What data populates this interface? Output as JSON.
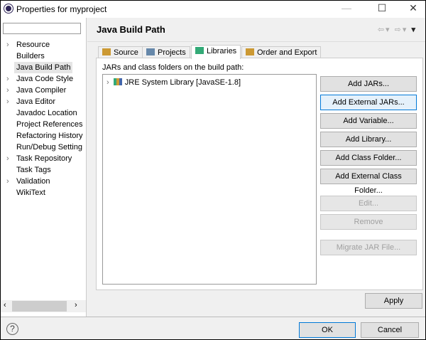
{
  "window": {
    "title": "Properties for myproject",
    "minimize": "—",
    "maximize": "☐",
    "close": "✕"
  },
  "sidebar": {
    "filter_value": "",
    "items": [
      {
        "label": "Resource",
        "expandable": true
      },
      {
        "label": "Builders",
        "expandable": false
      },
      {
        "label": "Java Build Path",
        "expandable": false,
        "selected": true
      },
      {
        "label": "Java Code Style",
        "expandable": true
      },
      {
        "label": "Java Compiler",
        "expandable": true
      },
      {
        "label": "Java Editor",
        "expandable": true
      },
      {
        "label": "Javadoc Location",
        "expandable": false
      },
      {
        "label": "Project References",
        "expandable": false
      },
      {
        "label": "Refactoring History",
        "expandable": false
      },
      {
        "label": "Run/Debug Setting",
        "expandable": false
      },
      {
        "label": "Task Repository",
        "expandable": true
      },
      {
        "label": "Task Tags",
        "expandable": false
      },
      {
        "label": "Validation",
        "expandable": true
      },
      {
        "label": "WikiText",
        "expandable": false
      }
    ]
  },
  "header": {
    "title": "Java Build Path"
  },
  "tabs": [
    {
      "label": "Source",
      "icon": "source-folder-icon"
    },
    {
      "label": "Projects",
      "icon": "folder-icon"
    },
    {
      "label": "Libraries",
      "icon": "library-icon",
      "active": true
    },
    {
      "label": "Order and Export",
      "icon": "order-icon"
    }
  ],
  "libraries": {
    "label": "JARs and class folders on the build path:",
    "items": [
      {
        "label": "JRE System Library [JavaSE-1.8]"
      }
    ]
  },
  "buttons": [
    {
      "label": "Add JARs...",
      "enabled": true
    },
    {
      "label": "Add External JARs...",
      "enabled": true,
      "focused": true
    },
    {
      "label": "Add Variable...",
      "enabled": true
    },
    {
      "label": "Add Library...",
      "enabled": true
    },
    {
      "label": "Add Class Folder...",
      "enabled": true
    },
    {
      "label": "Add External Class Folder...",
      "enabled": true
    },
    {
      "label": "Edit...",
      "enabled": false
    },
    {
      "label": "Remove",
      "enabled": false
    },
    {
      "label": "Migrate JAR File...",
      "enabled": false
    }
  ],
  "footer": {
    "apply": "Apply",
    "ok": "OK",
    "cancel": "Cancel",
    "help": "?"
  }
}
